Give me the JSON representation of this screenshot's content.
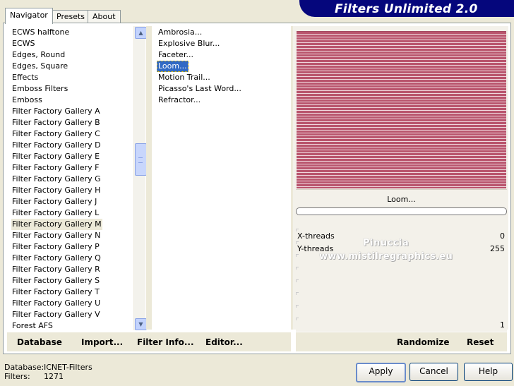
{
  "tabs": [
    {
      "label": "Navigator",
      "active": true
    },
    {
      "label": "Presets",
      "active": false
    },
    {
      "label": "About",
      "active": false
    }
  ],
  "header": {
    "title": "Filters Unlimited 2.0"
  },
  "categories": [
    "ECWS halftone",
    "ECWS",
    "Edges, Round",
    "Edges, Square",
    "Effects",
    "Emboss Filters",
    "Emboss",
    "Filter Factory Gallery A",
    "Filter Factory Gallery B",
    "Filter Factory Gallery C",
    "Filter Factory Gallery D",
    "Filter Factory Gallery E",
    "Filter Factory Gallery F",
    "Filter Factory Gallery G",
    "Filter Factory Gallery H",
    "Filter Factory Gallery J",
    "Filter Factory Gallery L",
    "Filter Factory Gallery M",
    "Filter Factory Gallery N",
    "Filter Factory Gallery P",
    "Filter Factory Gallery Q",
    "Filter Factory Gallery R",
    "Filter Factory Gallery S",
    "Filter Factory Gallery T",
    "Filter Factory Gallery U",
    "Filter Factory Gallery V",
    "Forest AFS"
  ],
  "selected_category": "Filter Factory Gallery M",
  "filters": [
    "Ambrosia...",
    "Explosive Blur...",
    "Faceter...",
    "Loom...",
    "Motion Trail...",
    "Picasso's Last Word...",
    "Refractor..."
  ],
  "selected_filter": "Loom...",
  "preview": {
    "filter_name": "Loom...",
    "stripe_color": "#b9556d",
    "gap_color": "#f0d7dd"
  },
  "params": [
    {
      "label": "X-threads",
      "value": "0"
    },
    {
      "label": "Y-threads",
      "value": "255"
    },
    {
      "label": "",
      "value": ""
    },
    {
      "label": "",
      "value": ""
    },
    {
      "label": "",
      "value": ""
    },
    {
      "label": "",
      "value": ""
    },
    {
      "label": "",
      "value": ""
    },
    {
      "label": "",
      "value": "1"
    }
  ],
  "watermark": {
    "line1": "Pinuccia",
    "line2": "www.mistilregraphics.eu"
  },
  "toolbar": {
    "database": "Database",
    "import": "Import...",
    "filter_info": "Filter Info...",
    "editor": "Editor...",
    "randomize": "Randomize",
    "reset": "Reset"
  },
  "status": {
    "database_label": "Database:",
    "database_value": "ICNET-Filters",
    "filters_label": "Filters:",
    "filters_value": "1271"
  },
  "buttons": {
    "apply": "Apply",
    "cancel": "Cancel",
    "help": "Help"
  },
  "colors": {
    "panel": "#ece9d8",
    "selection": "#316ac5",
    "banner": "#05067c"
  }
}
